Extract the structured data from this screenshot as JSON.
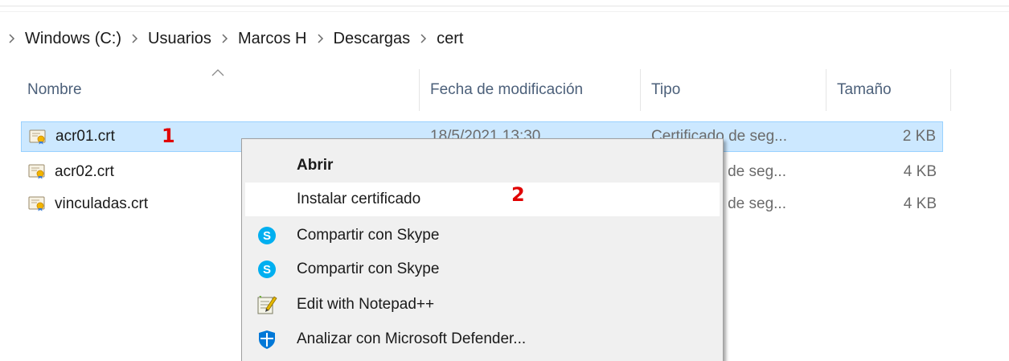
{
  "breadcrumb": {
    "items": [
      "Windows (C:)",
      "Usuarios",
      "Marcos H",
      "Descargas",
      "cert"
    ]
  },
  "columns": {
    "name": "Nombre",
    "date": "Fecha de modificación",
    "type": "Tipo",
    "size": "Tamaño"
  },
  "files": [
    {
      "name": "acr01.crt",
      "date": "18/5/2021 13:30",
      "type": "Certificado de seg...",
      "size": "2 KB",
      "selected": true
    },
    {
      "name": "acr02.crt",
      "date": "",
      "type": "Certificado de seg...",
      "size": "4 KB"
    },
    {
      "name": "vinculadas.crt",
      "date": "",
      "type": "Certificado de seg...",
      "size": "4 KB"
    }
  ],
  "annotations": {
    "step1": "1",
    "step2": "2"
  },
  "context_menu": {
    "items": [
      {
        "label": "Abrir",
        "icon": "none"
      },
      {
        "label": "Instalar certificado",
        "icon": "none"
      },
      {
        "label": "Compartir con Skype",
        "icon": "skype-icon"
      },
      {
        "label": "Compartir con Skype",
        "icon": "skype-icon"
      },
      {
        "label": "Edit with Notepad++",
        "icon": "notepad-plus-plus-icon"
      },
      {
        "label": "Analizar con Microsoft Defender...",
        "icon": "defender-shield-icon"
      }
    ]
  },
  "colors": {
    "selection_bg": "#cce8ff",
    "selection_border": "#99d1ff",
    "annotation_red": "#e00000",
    "skype_blue": "#00aff0",
    "defender_blue": "#0078d7"
  }
}
